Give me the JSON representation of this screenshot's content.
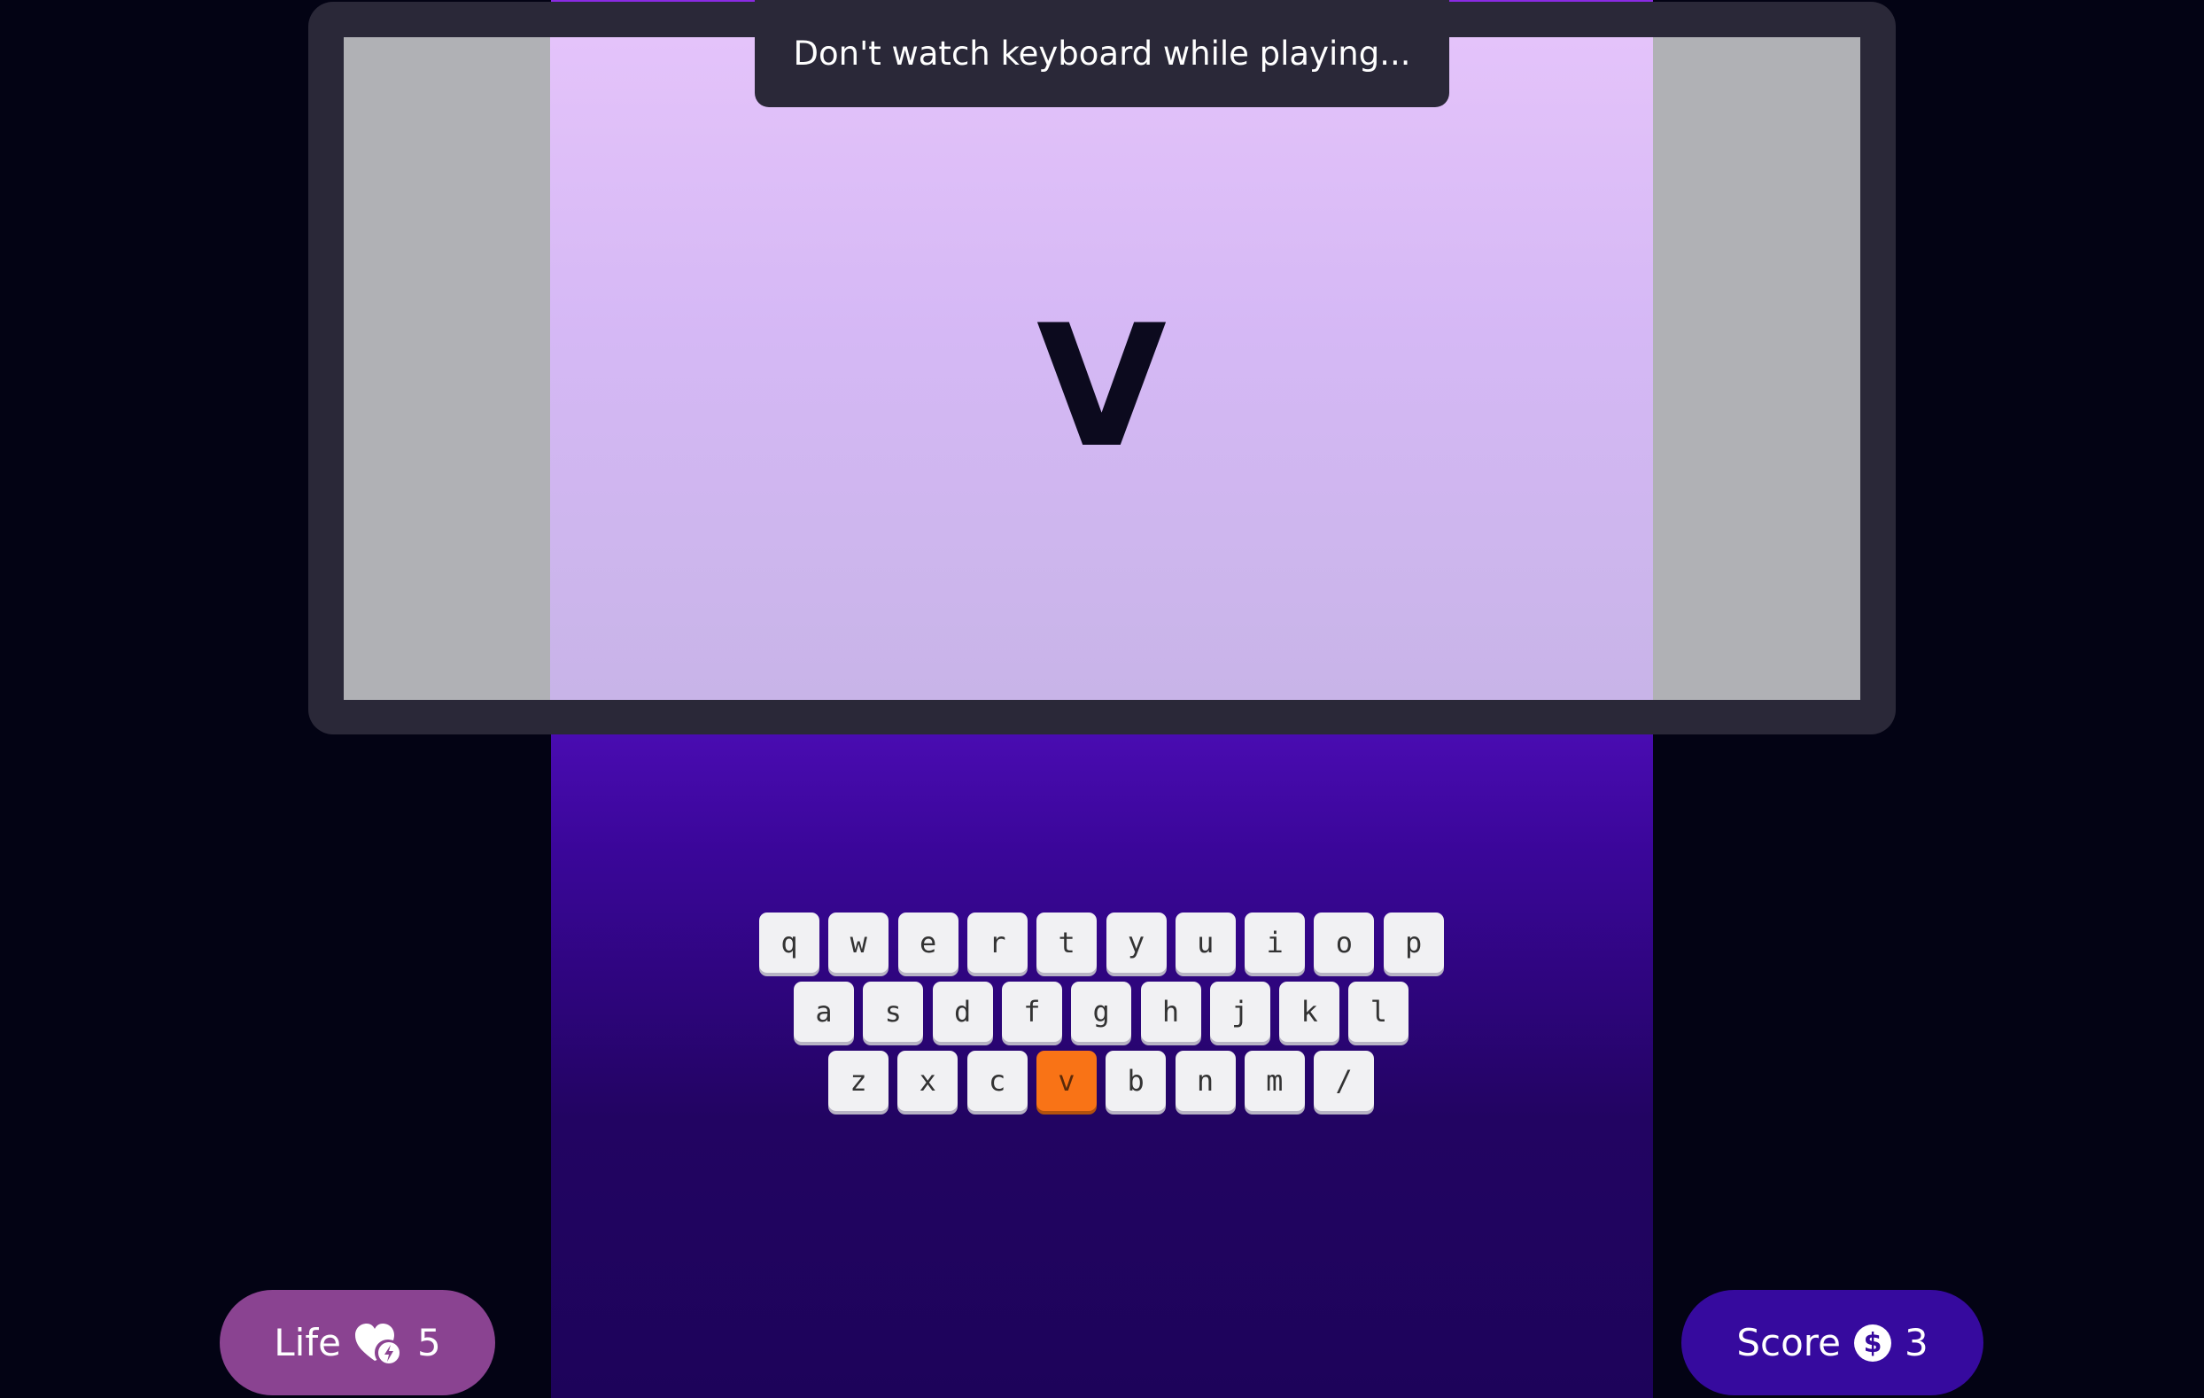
{
  "notice": "Don't watch keyboard while playing...",
  "current_letter": "V",
  "keyboard": {
    "rows": [
      [
        "q",
        "w",
        "e",
        "r",
        "t",
        "y",
        "u",
        "i",
        "o",
        "p"
      ],
      [
        "a",
        "s",
        "d",
        "f",
        "g",
        "h",
        "j",
        "k",
        "l"
      ],
      [
        "z",
        "x",
        "c",
        "v",
        "b",
        "n",
        "m",
        "/"
      ]
    ],
    "highlighted_key": "v",
    "highlight_color": "#f97316"
  },
  "life": {
    "label": "Life",
    "icon": "heart-bolt-icon",
    "value": "5"
  },
  "score": {
    "label": "Score",
    "icon": "dollar-coin-icon",
    "value": "3"
  },
  "colors": {
    "background": "#030314",
    "stage_top": "#4a0cb2",
    "stage_bottom": "#1d035a",
    "screen_top": "#e4c3fa",
    "screen_bottom": "#c8b4e8",
    "life_pill": "#8a4391",
    "score_pill": "#360a9e"
  }
}
